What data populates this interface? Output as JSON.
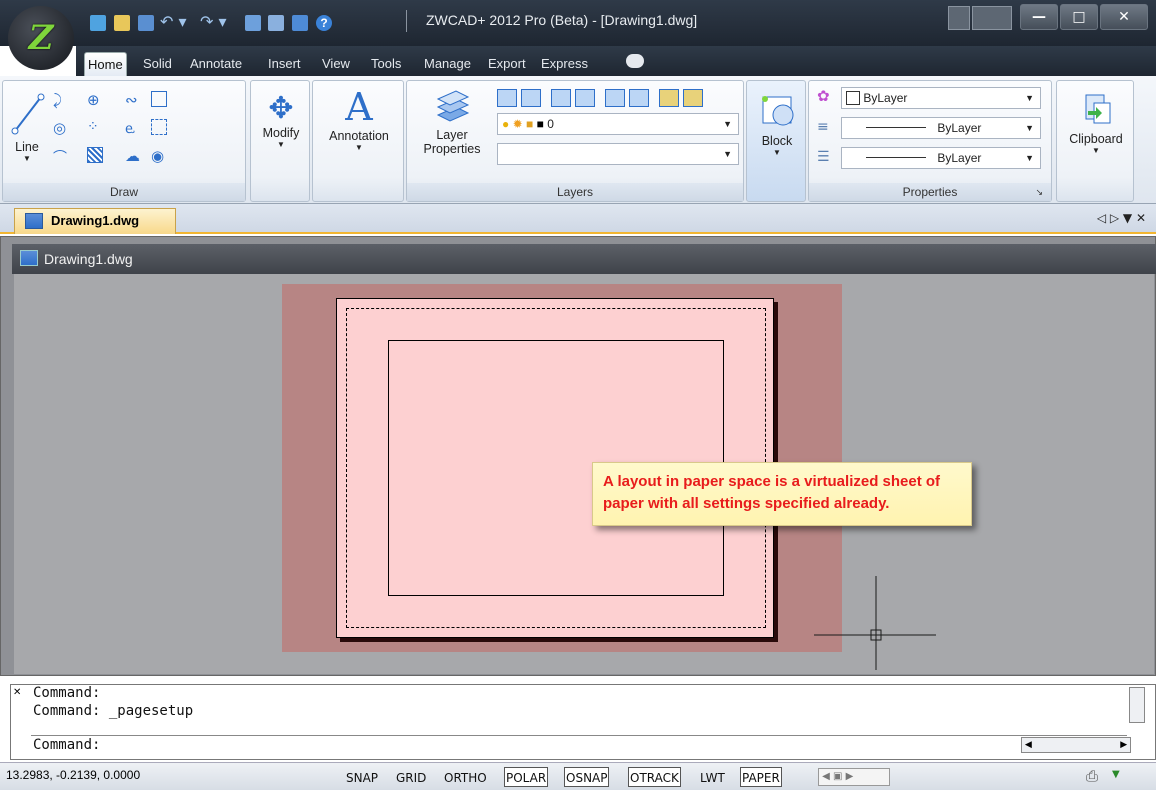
{
  "window": {
    "title": "ZWCAD+ 2012 Pro (Beta) - [Drawing1.dwg]",
    "logo_text": "Z"
  },
  "tabs": [
    {
      "label": "Home"
    },
    {
      "label": "Solid"
    },
    {
      "label": "Annotate"
    },
    {
      "label": "Insert"
    },
    {
      "label": "View"
    },
    {
      "label": "Tools"
    },
    {
      "label": "Manage"
    },
    {
      "label": "Export"
    },
    {
      "label": "Express"
    }
  ],
  "ribbon": {
    "draw": {
      "line_label": "Line",
      "panel_label": "Draw"
    },
    "modify_label": "Modify",
    "annotation_label": "Annotation",
    "layers": {
      "layer_properties_label": "Layer\nProperties",
      "layer_value": "0",
      "panel_label": "Layers"
    },
    "block_label": "Block",
    "properties": {
      "color": "ByLayer",
      "linetype": "ByLayer",
      "lineweight": "ByLayer",
      "panel_label": "Properties"
    },
    "clipboard_label": "Clipboard"
  },
  "document": {
    "tab_label": "Drawing1.dwg",
    "window_title": "Drawing1.dwg",
    "controls": "◁ ▷ ▼ ✕"
  },
  "callout": "A layout in paper space is a virtualized sheet of paper with all settings specified already.",
  "command": {
    "lines": [
      "Command:",
      "Command:  _pagesetup"
    ],
    "prompt": "Command:"
  },
  "status": {
    "coords": "13.2983, -0.2139, 0.0000",
    "buttons": [
      {
        "label": "SNAP",
        "on": false
      },
      {
        "label": "GRID",
        "on": false
      },
      {
        "label": "ORTHO",
        "on": false
      },
      {
        "label": "POLAR",
        "on": true
      },
      {
        "label": "OSNAP",
        "on": true
      },
      {
        "label": "OTRACK",
        "on": true
      },
      {
        "label": "LWT",
        "on": false
      },
      {
        "label": "PAPER",
        "on": true
      }
    ]
  }
}
